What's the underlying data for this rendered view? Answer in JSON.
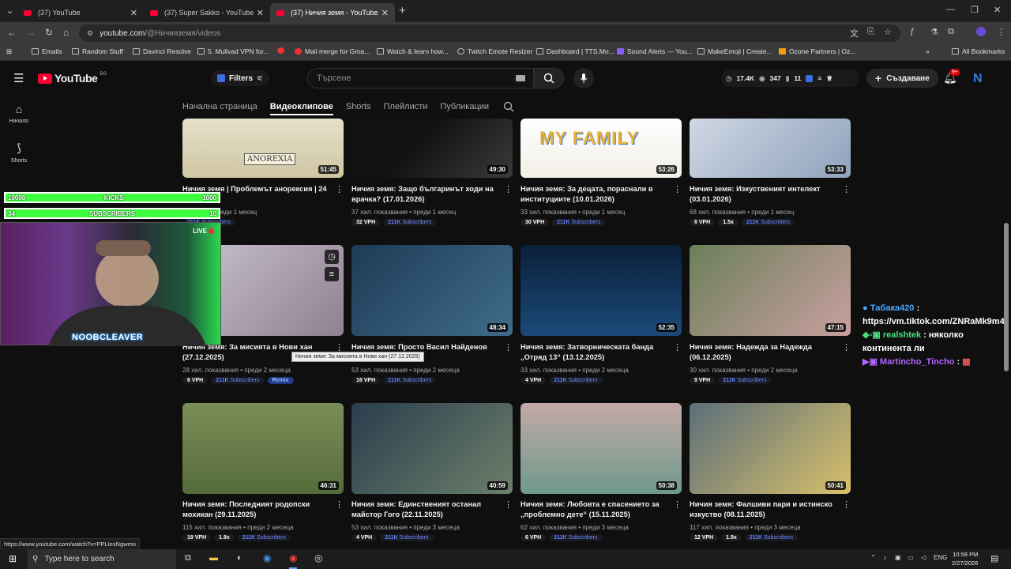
{
  "tabs": [
    {
      "title": "(37) YouTube"
    },
    {
      "title": "(37) Super Sakko - YouTube"
    },
    {
      "title": "(37) Ничия земя - YouTube"
    }
  ],
  "address": {
    "host": "youtube.com",
    "path": "/@Ничияземя/videos"
  },
  "bookmarks": [
    "Emails",
    "Random Stuff",
    "Davinci Resolve",
    "5. Mullvad VPN for...",
    "Mail merge for Gma...",
    "Watch & learn how...",
    "Twitch Emote Resizer",
    "Dashboard | TTS.Mo...",
    "Sound Alerts — You...",
    "MakeEmoji | Create...",
    "Ozone Partners | Oz...",
    "All Bookmarks"
  ],
  "yt": {
    "logo": "YouTube",
    "country": "BG",
    "filters_label": "Filters",
    "search_placeholder": "Търсене",
    "stats": {
      "views": "17.4K",
      "eye": "347",
      "count": "11"
    },
    "create_label": "Създаване",
    "notif_badge": "9+",
    "avatar_letter": "N"
  },
  "sidebar": {
    "home": "Начало",
    "shorts": "Shorts"
  },
  "channel_tabs": [
    "Начална страница",
    "Видеоклипове",
    "Shorts",
    "Плейлисти",
    "Публикации"
  ],
  "videos": [
    {
      "title": "Ничия земя | Проблемът анорексия | 24 ...6",
      "meta": "...ования • преди 1 месец",
      "duration": "51:45",
      "vph": "",
      "mult": "",
      "subs": "211K",
      "subs_label": "Subscribers",
      "remix": false
    },
    {
      "title": "Ничия земя: Защо българинът ходи на врачка? (17.01.2026)",
      "meta": "37 хил. показвания • преди 1 месец",
      "duration": "49:30",
      "vph": "32 VPH",
      "mult": "",
      "subs": "211K",
      "subs_label": "Subscribers",
      "remix": false
    },
    {
      "title": "Ничия земя: За децата, пораснали в институциите (10.01.2026)",
      "meta": "33 хил. показвания • преди 1 месец",
      "duration": "53:26",
      "vph": "30 VPH",
      "mult": "",
      "subs": "211K",
      "subs_label": "Subscribers",
      "remix": false
    },
    {
      "title": "Ничия земя: Изкуственият интелект (03.01.2026)",
      "meta": "68 хил. показвания • преди 1 месец",
      "duration": "53:33",
      "vph": "6 VPH",
      "mult": "1.5x",
      "subs": "211K",
      "subs_label": "Subscribers",
      "remix": false
    },
    {
      "title": "Ничия земя: За мисията в Нови хан (27.12.2025)",
      "meta": "28 хил. показвания • преди 2 месеца",
      "duration": "",
      "vph": "6 VPH",
      "mult": "",
      "subs": "211K",
      "subs_label": "Subscribers",
      "remix": true
    },
    {
      "title": "Ничия земя: Просто Васил Найденов",
      "meta": "53 хил. показвания • преди 2 месеца",
      "duration": "48:34",
      "vph": "16 VPH",
      "mult": "",
      "subs": "211K",
      "subs_label": "Subscribers",
      "remix": false
    },
    {
      "title": "Ничия земя: Затворническата банда „Отряд 13“ (13.12.2025)",
      "meta": "33 хил. показвания • преди 2 месеца",
      "duration": "52:35",
      "vph": "4 VPH",
      "mult": "",
      "subs": "211K",
      "subs_label": "Subscribers",
      "remix": false
    },
    {
      "title": "Ничия земя: Надежда за Надежда (06.12.2025)",
      "meta": "30 хил. показвания • преди 2 месеца",
      "duration": "47:15",
      "vph": "9 VPH",
      "mult": "",
      "subs": "211K",
      "subs_label": "Subscribers",
      "remix": false
    },
    {
      "title": "Ничия земя: Последният родопски мохикан (29.11.2025)",
      "meta": "115 хил. показвания • преди 2 месеца",
      "duration": "46:31",
      "vph": "19 VPH",
      "mult": "1.9x",
      "subs": "211K",
      "subs_label": "Subscribers",
      "remix": false
    },
    {
      "title": "Ничия земя: Единственият останал майстор Гого (22.11.2025)",
      "meta": "53 хил. показвания • преди 3 месеца",
      "duration": "40:59",
      "vph": "4 VPH",
      "mult": "",
      "subs": "211K",
      "subs_label": "Subscribers",
      "remix": false
    },
    {
      "title": "Ничия земя: Любовта е спасението за „проблемно дете“ (15.11.2025)",
      "meta": "62 хил. показвания • преди 3 месеца",
      "duration": "50:38",
      "vph": "6 VPH",
      "mult": "",
      "subs": "211K",
      "subs_label": "Subscribers",
      "remix": false
    },
    {
      "title": "Ничия земя: Фалшиви пари и истинско изкуство (08.11.2025)",
      "meta": "117 хил. показвания • преди 3 месеца",
      "duration": "50:41",
      "vph": "12 VPH",
      "mult": "1.9x",
      "subs": "211K",
      "subs_label": "Subscribers",
      "remix": false
    }
  ],
  "remix_label": "Remix",
  "thumb_text": {
    "anorexia": "ANOREXIA",
    "family": "MY FAMILY"
  },
  "overlay": {
    "kicks_count": "10000",
    "kicks_label": "KICKS",
    "kicks_goal": "1000",
    "subs_count": "34",
    "subs_label": "SUBSCRIBERS",
    "subs_goal": "10",
    "live": "LIVE",
    "cam_name": "NOOBCLEAVER"
  },
  "tooltip": "Ничия земя: За мисията в Нови хан (27.12.2025)",
  "chat": [
    {
      "user": "Tабака420",
      "text": "https://vm.tiktok.com/ZNRaMk9m4/"
    },
    {
      "user": "realshtek",
      "text": "няколко континента ли"
    },
    {
      "user": "Martincho_Tincho",
      "text": ""
    }
  ],
  "status_url": "https://www.youtube.com/watch?v=PPLIesNgwmo",
  "taskbar": {
    "search": "Type here to search",
    "lang": "ENG",
    "time": "10:58 PM",
    "date": "2/27/2026"
  }
}
